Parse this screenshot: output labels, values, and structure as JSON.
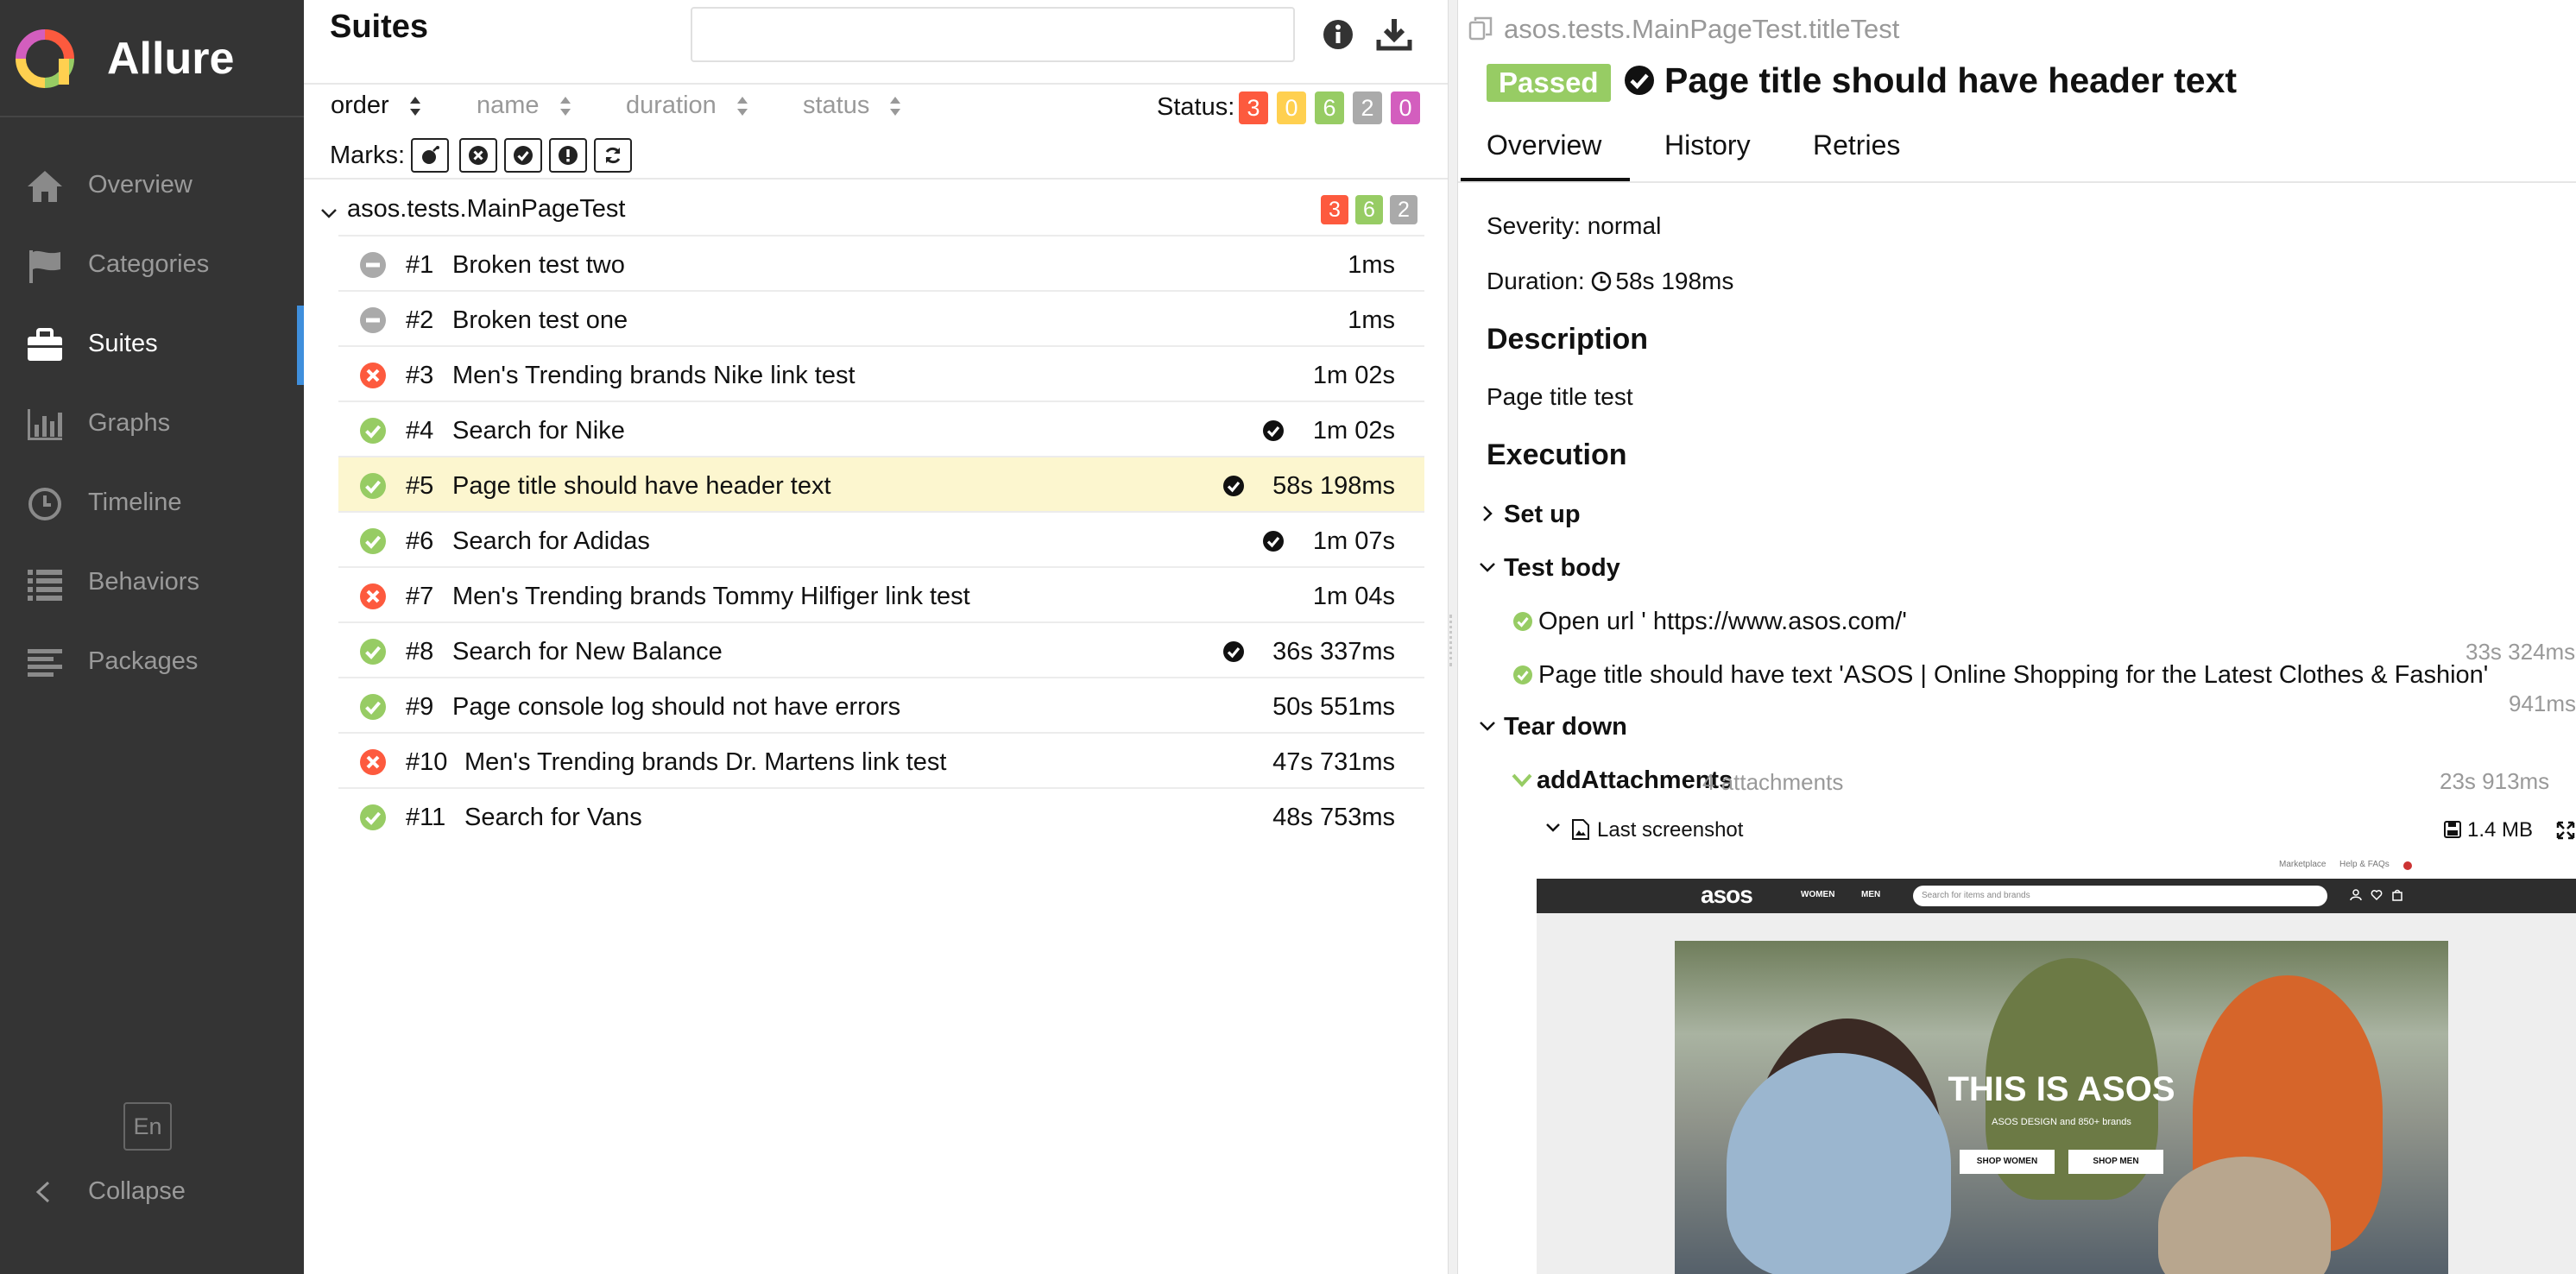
{
  "brand": {
    "name": "Allure"
  },
  "nav": [
    {
      "label": "Overview",
      "icon": "home-icon"
    },
    {
      "label": "Categories",
      "icon": "flag-icon"
    },
    {
      "label": "Suites",
      "icon": "briefcase-icon",
      "active": true
    },
    {
      "label": "Graphs",
      "icon": "bar-chart-icon"
    },
    {
      "label": "Timeline",
      "icon": "clock-icon"
    },
    {
      "label": "Behaviors",
      "icon": "list-icon"
    },
    {
      "label": "Packages",
      "icon": "align-left-icon"
    }
  ],
  "footer": {
    "lang": "En",
    "collapse": "Collapse"
  },
  "suites": {
    "title": "Suites",
    "search_placeholder": "",
    "sort": {
      "order": "order",
      "name": "name",
      "duration": "duration",
      "status": "status"
    },
    "status_label": "Status:",
    "status_counts": [
      {
        "status": "failed",
        "count": "3",
        "color": "#fd5a3e"
      },
      {
        "status": "broken",
        "count": "0",
        "color": "#ffd050"
      },
      {
        "status": "passed",
        "count": "6",
        "color": "#97cc64"
      },
      {
        "status": "skipped",
        "count": "2",
        "color": "#aaaaaa"
      },
      {
        "status": "unknown",
        "count": "0",
        "color": "#d35ebe"
      }
    ],
    "marks_label": "Marks:",
    "marks": [
      "flaky-icon",
      "new-failed-icon",
      "new-passed-icon",
      "new-broken-icon",
      "retries-icon"
    ],
    "group": {
      "name": "asos.tests.MainPageTest",
      "counts": [
        {
          "count": "3",
          "color": "#fd5a3e"
        },
        {
          "count": "6",
          "color": "#97cc64"
        },
        {
          "count": "2",
          "color": "#aaaaaa"
        }
      ]
    },
    "tests": [
      {
        "num": "#1",
        "name": "Broken test two",
        "duration": "1ms",
        "status": "skipped",
        "flag": false
      },
      {
        "num": "#2",
        "name": "Broken test one",
        "duration": "1ms",
        "status": "skipped",
        "flag": false
      },
      {
        "num": "#3",
        "name": "Men's Trending brands Nike link test",
        "duration": "1m 02s",
        "status": "failed",
        "flag": false
      },
      {
        "num": "#4",
        "name": "Search for Nike",
        "duration": "1m 02s",
        "status": "passed",
        "flag": true
      },
      {
        "num": "#5",
        "name": "Page title should have header text",
        "duration": "58s 198ms",
        "status": "passed",
        "flag": true,
        "selected": true
      },
      {
        "num": "#6",
        "name": "Search for Adidas",
        "duration": "1m 07s",
        "status": "passed",
        "flag": true
      },
      {
        "num": "#7",
        "name": "Men's Trending brands Tommy Hilfiger link test",
        "duration": "1m 04s",
        "status": "failed",
        "flag": false
      },
      {
        "num": "#8",
        "name": "Search for New Balance",
        "duration": "36s 337ms",
        "status": "passed",
        "flag": true
      },
      {
        "num": "#9",
        "name": "Page console log should not have errors",
        "duration": "50s 551ms",
        "status": "passed",
        "flag": false
      },
      {
        "num": "#10",
        "name": "Men's Trending brands Dr. Martens link test",
        "duration": "47s 731ms",
        "status": "failed",
        "flag": false
      },
      {
        "num": "#11",
        "name": "Search for Vans",
        "duration": "48s 753ms",
        "status": "passed",
        "flag": false
      }
    ]
  },
  "detail": {
    "path": "asos.tests.MainPageTest.titleTest",
    "status": "Passed",
    "status_color": "#97cc64",
    "title": "Page title should have header text",
    "tabs": [
      "Overview",
      "History",
      "Retries"
    ],
    "severity": "Severity: normal",
    "duration_label": "Duration:",
    "duration": "58s 198ms",
    "description_heading": "Description",
    "description": "Page title test",
    "execution_heading": "Execution",
    "setup_label": "Set up",
    "test_body_label": "Test body",
    "steps": [
      {
        "text": "Open url ' https://www.asos.com/'",
        "time": "33s 324ms"
      },
      {
        "text": "Page title should have text 'ASOS | Online Shopping for the Latest Clothes & Fashion'",
        "time": "941ms"
      }
    ],
    "teardown_label": "Tear down",
    "attachment_step": {
      "name": "addAttachments",
      "count": "4 attachments",
      "time": "23s 913ms"
    },
    "attachment": {
      "name": "Last screenshot",
      "size": "1.4 MB"
    }
  },
  "screenshot": {
    "top_links": [
      "Marketplace",
      "Help & FAQs"
    ],
    "logo": "asos",
    "tabs": [
      "WOMEN",
      "MEN"
    ],
    "search_placeholder": "Search for items and brands",
    "hero_title": "THIS IS ASOS",
    "hero_subtitle": "ASOS DESIGN and 850+ brands",
    "buttons": [
      "SHOP WOMEN",
      "SHOP MEN"
    ]
  }
}
